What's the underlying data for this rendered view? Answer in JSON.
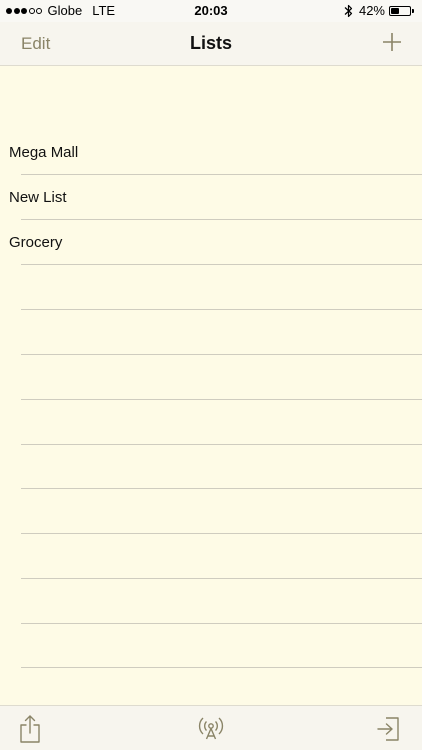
{
  "status_bar": {
    "signal": {
      "filled": 3,
      "total": 5
    },
    "carrier": "Globe",
    "network": "LTE",
    "time": "20:03",
    "battery_percent": "42%",
    "battery_level": 0.42,
    "icons": [
      "bluetooth-icon",
      "battery-icon"
    ]
  },
  "nav": {
    "edit_label": "Edit",
    "title": "Lists",
    "add_icon": "plus-icon"
  },
  "lists": {
    "items": [
      {
        "label": "Mega Mall"
      },
      {
        "label": "New List"
      },
      {
        "label": "Grocery"
      }
    ]
  },
  "toolbar": {
    "icons": [
      "share-icon",
      "broadcast-icon",
      "sign-in-icon"
    ]
  },
  "colors": {
    "background": "#fefbe6",
    "bar_background": "#f7f5ee",
    "accent": "#8a8467",
    "separator": "#cfccbf"
  }
}
